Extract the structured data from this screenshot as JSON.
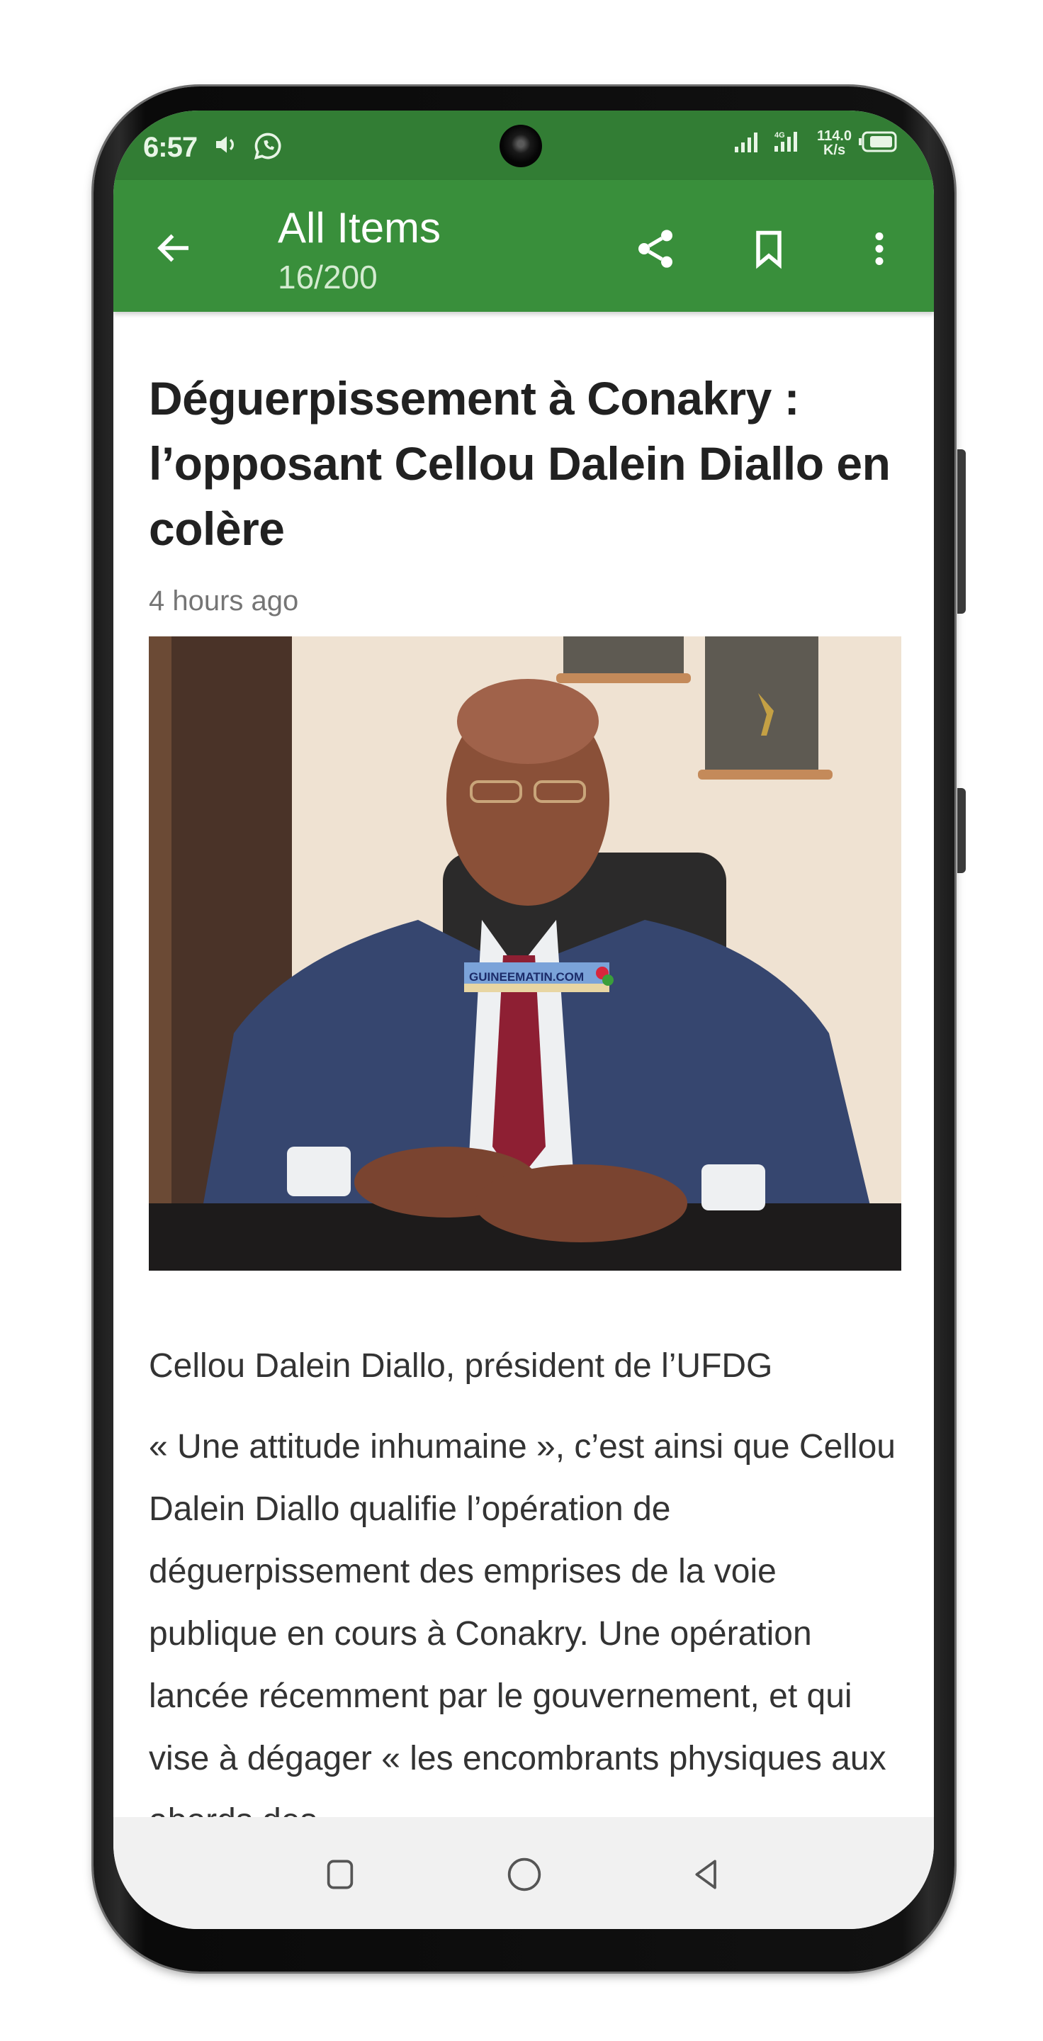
{
  "status_bar": {
    "time": "6:57",
    "icons": [
      "volume-icon",
      "whatsapp-icon"
    ],
    "network_speed_value": "114.0",
    "network_speed_unit": "K/s",
    "signal_label": "4G",
    "battery_icon": "battery-icon"
  },
  "app_bar": {
    "title": "All Items",
    "subtitle": "16/200",
    "back_icon": "arrow-left-icon",
    "actions": [
      {
        "name": "share",
        "icon": "share-icon"
      },
      {
        "name": "bookmark",
        "icon": "bookmark-icon"
      },
      {
        "name": "more",
        "icon": "more-vertical-icon"
      }
    ],
    "colors": {
      "status_bar": "#327d34",
      "app_bar": "#398f3b"
    }
  },
  "article": {
    "headline": "Déguerpissement à Conakry : l’opposant Cellou Dalein Diallo en colère",
    "time_ago": "4 hours ago",
    "image": {
      "description": "Portrait of Cellou Dalein Diallo in a blue suit and red tie, seated at a desk",
      "watermark": "GUINEEMATIN.COM"
    },
    "caption": "Cellou Dalein Diallo, président de l’UFDG",
    "body": "« Une attitude inhumaine », c’est ainsi que Cellou Dalein Diallo qualifie l’opération de déguerpissement des emprises de la voie publique en cours à Conakry. Une opération lancée récemment par le gouvernement, et qui vise à dégager « les encombrants physiques aux abords des"
  },
  "nav_bar": {
    "buttons": [
      {
        "name": "recents",
        "icon": "square-icon"
      },
      {
        "name": "home",
        "icon": "circle-icon"
      },
      {
        "name": "back",
        "icon": "triangle-back-icon"
      }
    ]
  }
}
